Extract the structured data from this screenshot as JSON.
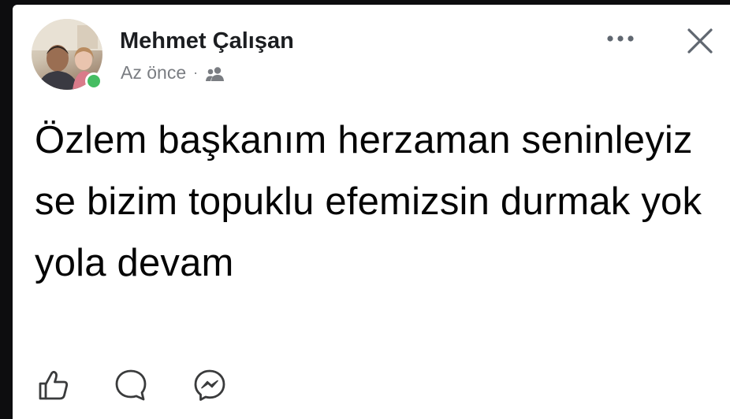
{
  "post": {
    "author": "Mehmet Çalışan",
    "timestamp": "Az önce",
    "separator": "·",
    "audience_icon": "friends-icon",
    "text": "Özlem başkanım herzaman seninleyiz se bizim topuklu efemizsin durmak yok yola devam",
    "online": true
  },
  "header": {
    "more_icon": "more-options-icon",
    "close_icon": "close-icon"
  },
  "actions": [
    {
      "icon": "like-icon"
    },
    {
      "icon": "comment-icon"
    },
    {
      "icon": "messenger-share-icon"
    }
  ],
  "colors": {
    "author": "#1c1e21",
    "meta": "#7a7d82",
    "online": "#45bd62",
    "text": "#050505"
  }
}
